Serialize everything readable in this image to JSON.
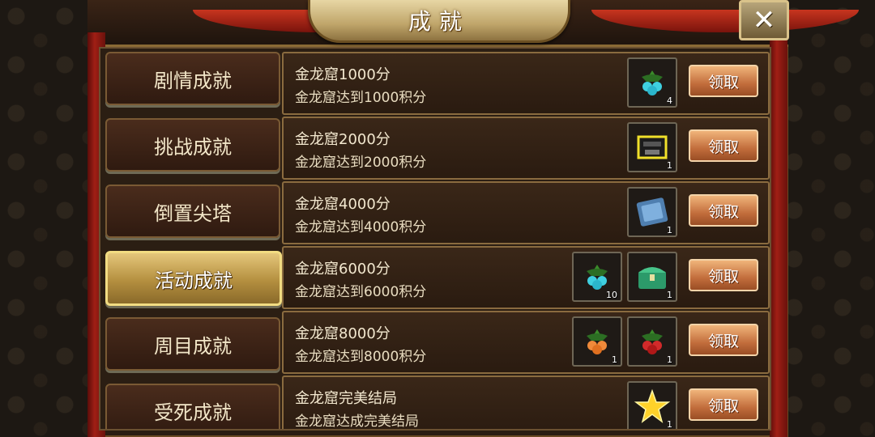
{
  "window": {
    "title": "成就",
    "close_label": "✕"
  },
  "tabs": [
    {
      "label": "剧情成就",
      "active": false
    },
    {
      "label": "挑战成就",
      "active": false
    },
    {
      "label": "倒置尖塔",
      "active": false
    },
    {
      "label": "活动成就",
      "active": true
    },
    {
      "label": "周目成就",
      "active": false
    },
    {
      "label": "受死成就",
      "active": false
    }
  ],
  "claim_label": "领取",
  "achievements": [
    {
      "title": "金龙窟1000分",
      "desc": "金龙窟达到1000积分",
      "rewards": [
        {
          "icon": "cyan-fruit-icon",
          "count": "4"
        }
      ]
    },
    {
      "title": "金龙窟2000分",
      "desc": "金龙窟达到2000积分",
      "rewards": [
        {
          "icon": "treasure-box-icon",
          "count": "1"
        }
      ]
    },
    {
      "title": "金龙窟4000分",
      "desc": "金龙窟达到4000积分",
      "rewards": [
        {
          "icon": "blue-scroll-icon",
          "count": "1"
        }
      ]
    },
    {
      "title": "金龙窟6000分",
      "desc": "金龙窟达到6000积分",
      "rewards": [
        {
          "icon": "cyan-fruit-icon",
          "count": "10"
        },
        {
          "icon": "green-chest-icon",
          "count": "1"
        }
      ]
    },
    {
      "title": "金龙窟8000分",
      "desc": "金龙窟达到8000积分",
      "rewards": [
        {
          "icon": "orange-fruit-icon",
          "count": "1"
        },
        {
          "icon": "red-fruit-icon",
          "count": "1"
        }
      ]
    },
    {
      "title": "金龙窟完美结局",
      "desc": "金龙窟达成完美结局",
      "rewards": [
        {
          "icon": "gold-star-icon",
          "count": "1"
        }
      ]
    }
  ]
}
